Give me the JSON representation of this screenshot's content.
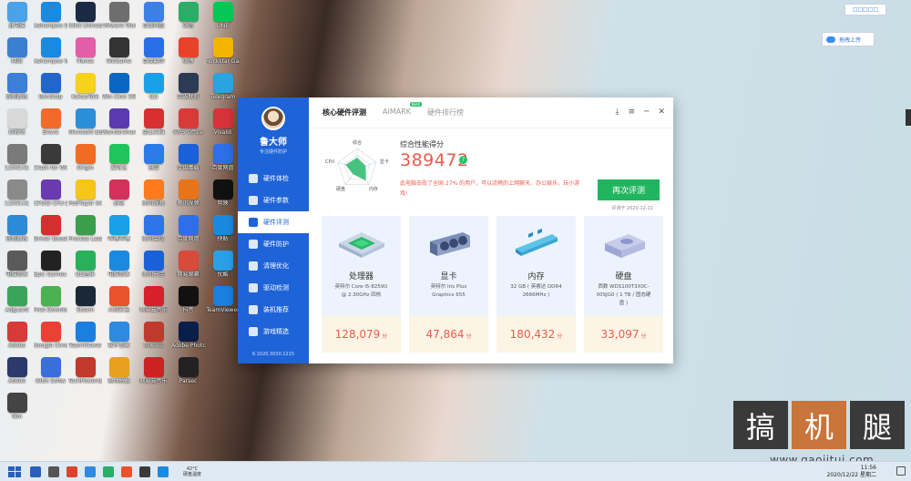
{
  "desktop": {
    "columns": [
      [
        {
          "label": "此电脑",
          "color": "#4aa3e8"
        },
        {
          "label": "网络",
          "color": "#3c7fd1"
        },
        {
          "label": "控制面板",
          "color": "#3d7fd8"
        },
        {
          "label": "回收站",
          "color": "#d8d8d8"
        },
        {
          "label": "1240141",
          "color": "#7a7a7a"
        },
        {
          "label": "1240141",
          "color": "#8a8a8a"
        },
        {
          "label": "控制面板",
          "color": "#2d8ad8"
        },
        {
          "label": "电脑管家",
          "color": "#5a5a5a"
        },
        {
          "label": "Adguard",
          "color": "#3aa55a"
        },
        {
          "label": "Adobe",
          "color": "#d83a3a"
        },
        {
          "label": "Adobe",
          "color": "#2b3a6b"
        },
        {
          "label": "Win",
          "color": "#444"
        }
      ],
      [
        {
          "label": "Ashampoo Driver",
          "color": "#1a8ae0"
        },
        {
          "label": "Ashampoo WinOptimi",
          "color": "#1a8ae0"
        },
        {
          "label": "Bandizip",
          "color": "#2266cc"
        },
        {
          "label": "Brave",
          "color": "#f06a2a"
        },
        {
          "label": "Clash for Windows",
          "color": "#3a3a3a"
        },
        {
          "label": "CPUID CPU-Z",
          "color": "#6a3ab0"
        },
        {
          "label": "Driver Booster",
          "color": "#d32f2f"
        },
        {
          "label": "Epic Games Launcher",
          "color": "#222"
        },
        {
          "label": "Free Downlo",
          "color": "#4caf50"
        },
        {
          "label": "Google Chrome",
          "color": "#e94235"
        },
        {
          "label": "IObit Softw",
          "color": "#3a6ed8"
        }
      ],
      [
        {
          "label": "IObit Uninstaller",
          "color": "#1b2a44"
        },
        {
          "label": "iTunes",
          "color": "#e25ea8"
        },
        {
          "label": "KakaoTalk",
          "color": "#f7d21a"
        },
        {
          "label": "Microsoft Edge",
          "color": "#2b8fd8"
        },
        {
          "label": "Origin",
          "color": "#f26b22"
        },
        {
          "label": "PotPlayer 64 bit",
          "color": "#f5c518"
        },
        {
          "label": "Process Lasso",
          "color": "#3a9e4a"
        },
        {
          "label": "QQ音乐",
          "color": "#2ab05a"
        },
        {
          "label": "Steam",
          "color": "#1b2838"
        },
        {
          "label": "TeamViewer",
          "color": "#1b7fe0"
        },
        {
          "label": "TechPowerUp GPU-Z",
          "color": "#c0392b"
        }
      ],
      [
        {
          "label": "VMware Workstati",
          "color": "#6e6e6e"
        },
        {
          "label": "WeGame",
          "color": "#333"
        },
        {
          "label": "Win Cine 365",
          "color": "#0a66c2"
        },
        {
          "label": "Wondershare UniConver",
          "color": "#5a3ab0"
        },
        {
          "label": "爱奇艺",
          "color": "#21c45a"
        },
        {
          "label": "必剪",
          "color": "#d4315a"
        },
        {
          "label": "哔哩哔哩",
          "color": "#1aa0e8"
        },
        {
          "label": "电脑管家",
          "color": "#1a8ae0"
        },
        {
          "label": "火绒安全",
          "color": "#e8532b"
        },
        {
          "label": "软件管家",
          "color": "#2d8ae0"
        },
        {
          "label": "驱动总裁",
          "color": "#e8a020"
        }
      ],
      [
        {
          "label": "百度网盘",
          "color": "#3a80e8"
        },
        {
          "label": "百度翻译",
          "color": "#2a6fe8"
        },
        {
          "label": "QQ",
          "color": "#1aa0e8"
        },
        {
          "label": "金山文档",
          "color": "#d83030"
        },
        {
          "label": "迅雷",
          "color": "#2a7ae8"
        },
        {
          "label": "腾讯视频",
          "color": "#ff7a1a"
        },
        {
          "label": "腾讯会议",
          "color": "#2d74e8"
        },
        {
          "label": "腾讯元宝",
          "color": "#1a60d8"
        },
        {
          "label": "网易云音乐",
          "color": "#d8202a"
        },
        {
          "label": "网易UU",
          "color": "#c0392b"
        },
        {
          "label": "网易云音乐",
          "color": "#c22"
        }
      ],
      [
        {
          "label": "微信",
          "color": "#2aae67"
        },
        {
          "label": "微博",
          "color": "#e8432a"
        },
        {
          "label": "英雄联盟",
          "color": "#2b3a55"
        },
        {
          "label": "WPS Office",
          "color": "#d83a3a"
        },
        {
          "label": "金山毒霸",
          "color": "#1a60d8"
        },
        {
          "label": "腾讯视频",
          "color": "#e8741a"
        },
        {
          "label": "百度网盘",
          "color": "#2d6fe8"
        },
        {
          "label": "网易邮箱",
          "color": "#d84a3a"
        },
        {
          "label": "抖音",
          "color": "#111"
        },
        {
          "label": "Adobe Photosh",
          "color": "#0a1e4a"
        },
        {
          "label": "Parsec",
          "color": "#222"
        }
      ],
      [
        {
          "label": "LINE",
          "color": "#06c755"
        },
        {
          "label": "Rockstar Games",
          "color": "#f4b400"
        },
        {
          "label": "Telegram",
          "color": "#2aa3e0"
        },
        {
          "label": "Vivaldi",
          "color": "#d8323a"
        },
        {
          "label": "百度网盘",
          "color": "#2d6fe8"
        },
        {
          "label": "剪映",
          "color": "#111"
        },
        {
          "label": "快贴",
          "color": "#1a8ae0"
        },
        {
          "label": "优酷",
          "color": "#2aa0e8"
        },
        {
          "label": "TeamViewer",
          "color": "#1b7fe0"
        }
      ]
    ]
  },
  "widgets": {
    "mini_label": "□□□□□",
    "upload_label": "拖拽上传"
  },
  "app": {
    "brand": "鲁大师",
    "brand_sub": "专注硬件防护",
    "nav": [
      {
        "label": "硬件体检",
        "active": false
      },
      {
        "label": "硬件参数",
        "active": false
      },
      {
        "label": "硬件评测",
        "active": true
      },
      {
        "label": "硬件防护",
        "active": false
      },
      {
        "label": "清理优化",
        "active": false
      },
      {
        "label": "驱动检测",
        "active": false
      },
      {
        "label": "装机推荐",
        "active": false
      },
      {
        "label": "游戏精选",
        "active": false
      }
    ],
    "version": "6.1020.3030.1215",
    "tabs": [
      {
        "label": "核心硬件评测",
        "active": true,
        "badge": ""
      },
      {
        "label": "AIMARK",
        "active": false,
        "badge": "NEW"
      },
      {
        "label": "硬件排行榜",
        "active": false,
        "badge": ""
      }
    ],
    "controls": {
      "download": "⤓",
      "menu": "≡",
      "minimize": "─",
      "close": "✕"
    },
    "radar_labels": [
      "综合",
      "显卡",
      "内存",
      "硬盘",
      "CPU"
    ],
    "radar_values": [
      0.55,
      0.45,
      0.75,
      0.35,
      0.6
    ],
    "score_title": "综合性能得分",
    "score": "389472",
    "score_help": "?",
    "score_desc": "此电脑击败了全国 27% 的用户，可以流畅的上网聊天、办公娱乐，玩小游戏!",
    "retest_label": "再次评测",
    "eval_date": "评测于 2020-12-22",
    "cards": [
      {
        "title": "处理器",
        "spec": "英特尔 Core i5-8259U @ 2.30GHz 四核",
        "score": "128,079",
        "unit": "分",
        "kind": "cpu"
      },
      {
        "title": "显卡",
        "spec": "英特尔 Iris Plus Graphics 655",
        "score": "47,864",
        "unit": "分",
        "kind": "gpu"
      },
      {
        "title": "内存",
        "spec": "32 GB ( 英睿达 DDR4 2666MHz )",
        "score": "180,432",
        "unit": "分",
        "kind": "ram"
      },
      {
        "title": "硬盘",
        "spec": "西数 WDS100T3X0C-00SJG0 ( 1 TB / 固态硬盘 )",
        "score": "33,097",
        "unit": "分",
        "kind": "disk"
      }
    ]
  },
  "watermark": {
    "chars": [
      "搞",
      "机",
      "腿"
    ],
    "colors": [
      "#3a3a3a",
      "#c8743a",
      "#3a3a3a"
    ],
    "url": "www.gaojitui.com"
  },
  "taskbar": {
    "temp": "42°C",
    "temp_label": "硬盘温度",
    "time": "11:56",
    "date": "2020/12/22 星期二",
    "icons": [
      "#2b5fb9",
      "#555",
      "#d9452a",
      "#2d8ae0",
      "#2aae67",
      "#e8532b",
      "#3a3a3a",
      "#1a8ae0"
    ]
  }
}
